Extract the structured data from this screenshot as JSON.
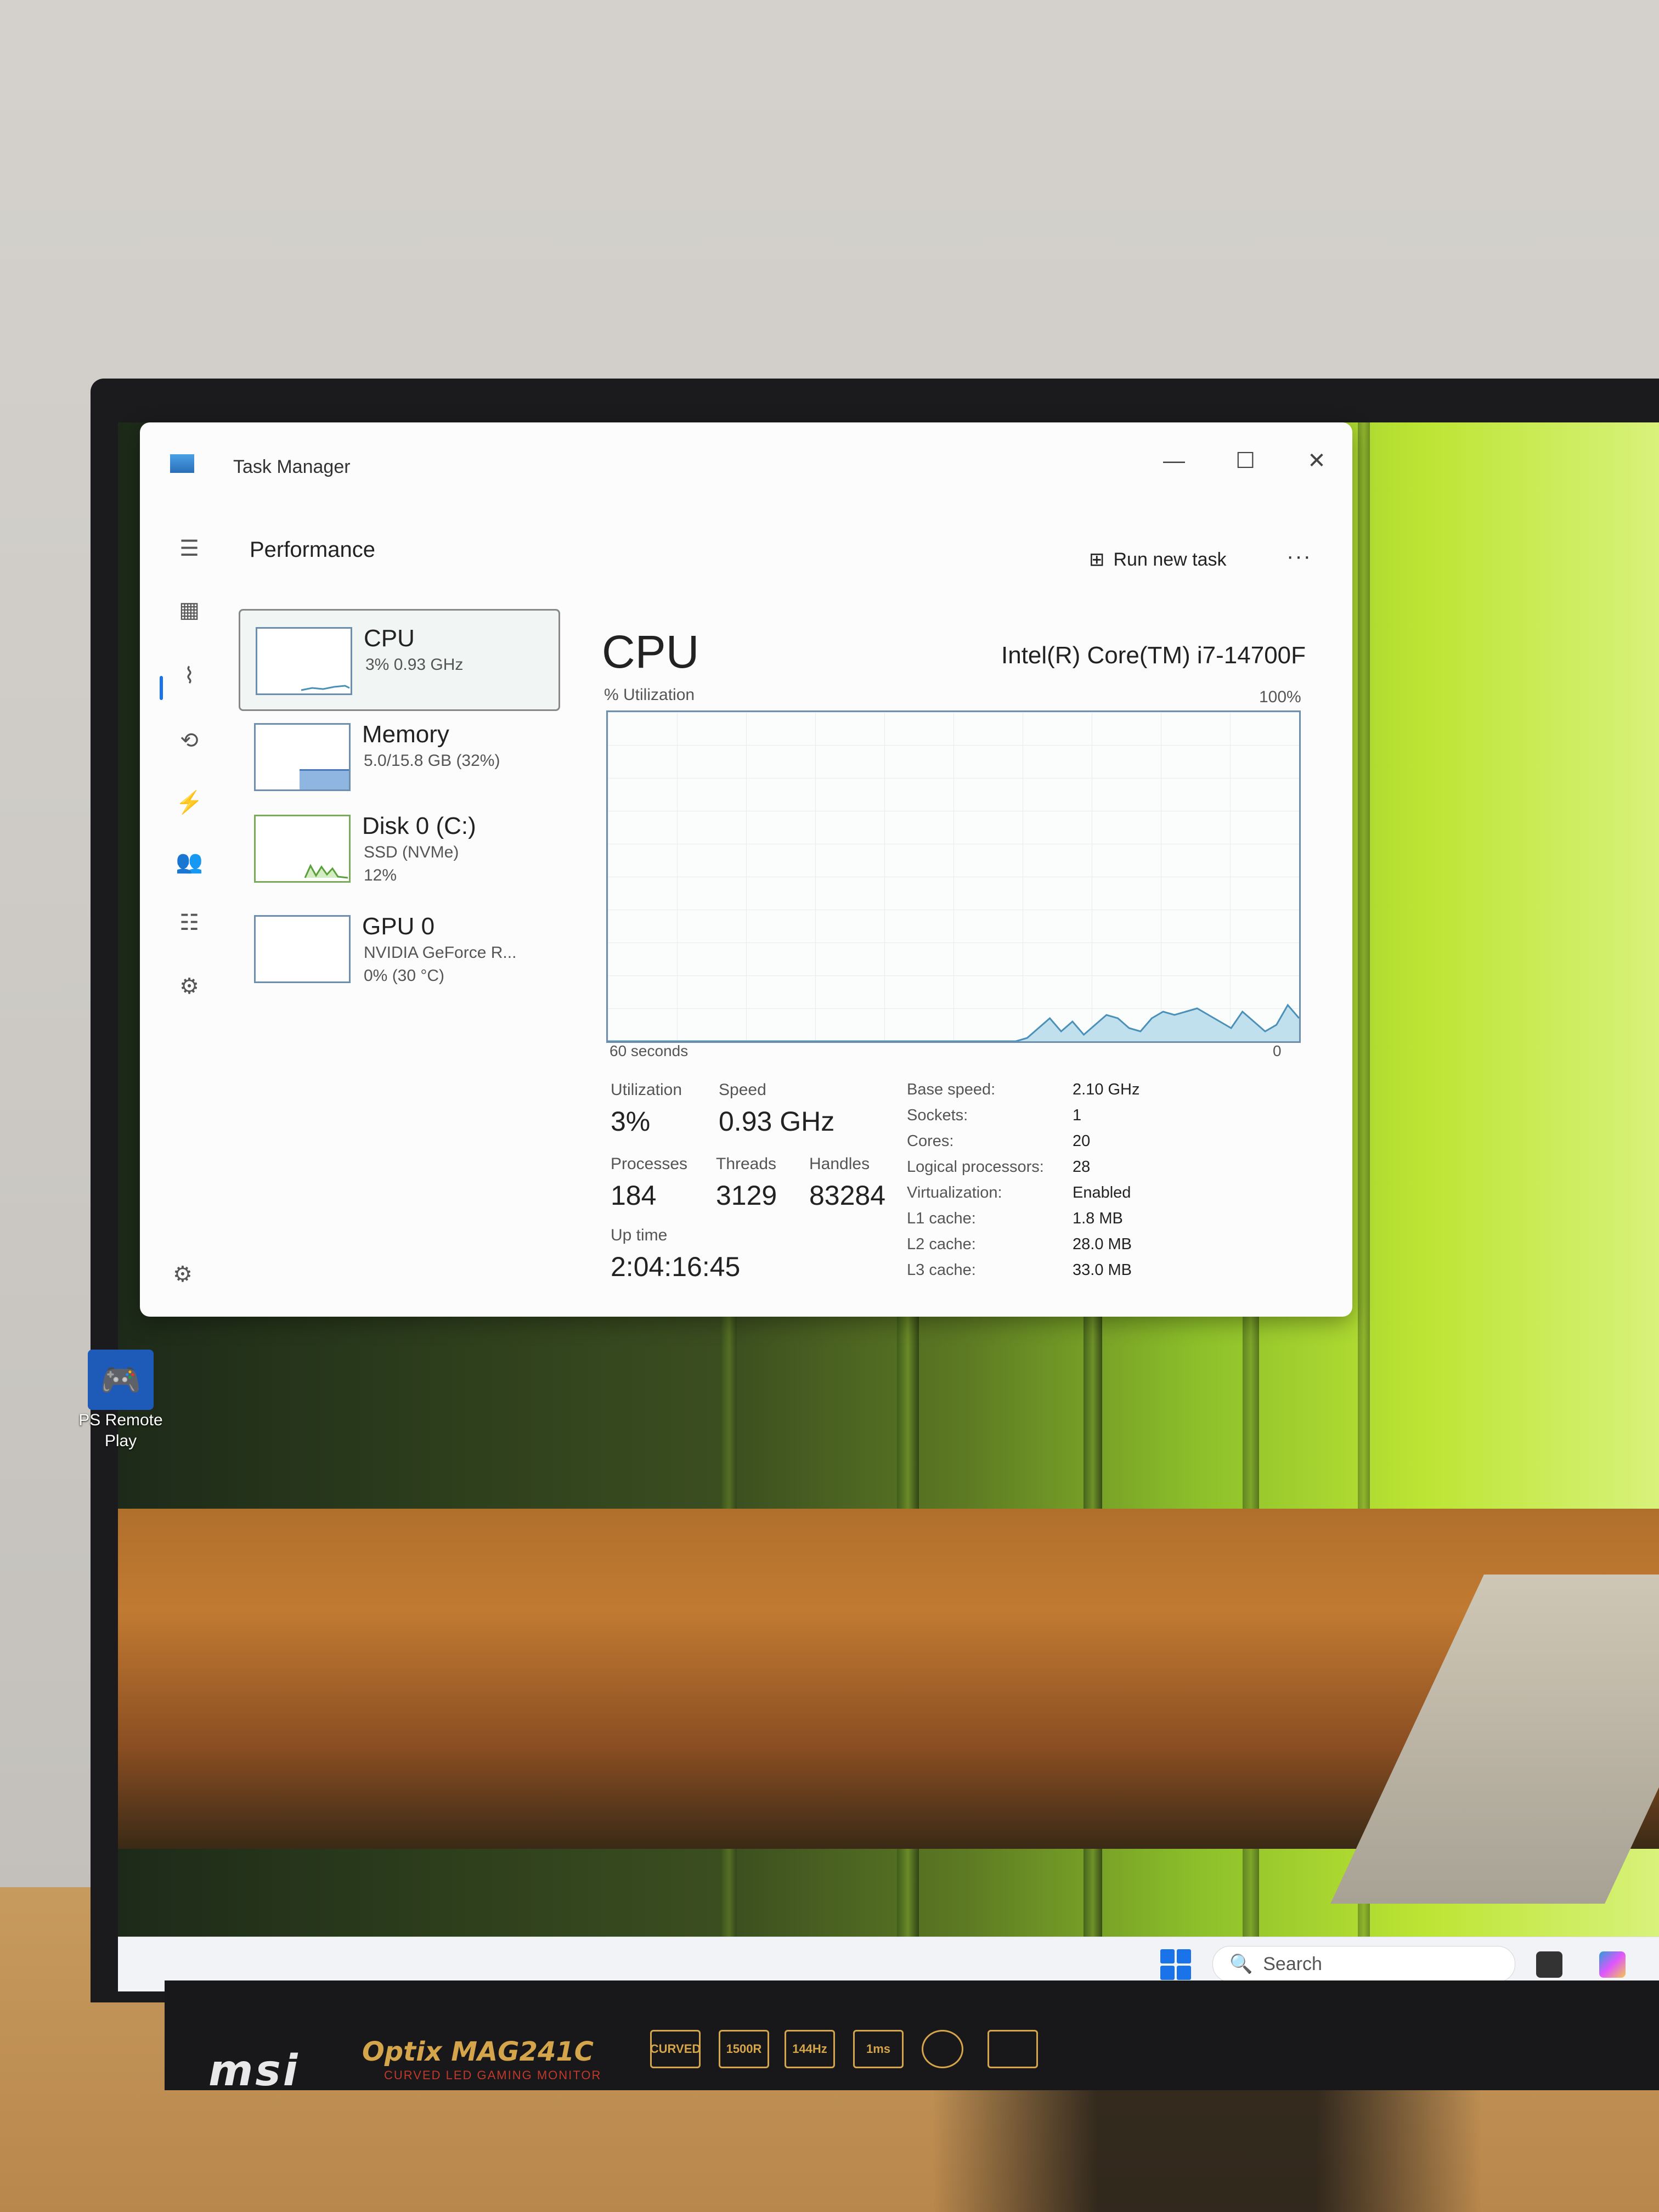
{
  "window": {
    "title": "Task Manager",
    "minimize_glyph": "—",
    "maximize_glyph": "☐",
    "close_glyph": "✕"
  },
  "toolbar": {
    "section": "Performance",
    "run_new_task": "Run new task",
    "more": "···"
  },
  "sidebar": [
    {
      "name": "CPU",
      "sub1": "3% 0.93 GHz",
      "sub2": ""
    },
    {
      "name": "Memory",
      "sub1": "5.0/15.8 GB (32%)",
      "sub2": ""
    },
    {
      "name": "Disk 0 (C:)",
      "sub1": "SSD (NVMe)",
      "sub2": "12%"
    },
    {
      "name": "GPU 0",
      "sub1": "NVIDIA GeForce R...",
      "sub2": "0% (30 °C)"
    }
  ],
  "main": {
    "title": "CPU",
    "model": "Intel(R) Core(TM) i7-14700F",
    "graph_label": "% Utilization",
    "graph_max": "100%",
    "graph_time": "60 seconds",
    "graph_min": "0"
  },
  "stats": {
    "utilization_label": "Utilization",
    "utilization": "3%",
    "speed_label": "Speed",
    "speed": "0.93 GHz",
    "processes_label": "Processes",
    "processes": "184",
    "threads_label": "Threads",
    "threads": "3129",
    "handles_label": "Handles",
    "handles": "83284",
    "uptime_label": "Up time",
    "uptime": "2:04:16:45"
  },
  "specs": [
    {
      "label": "Base speed:",
      "value": "2.10 GHz"
    },
    {
      "label": "Sockets:",
      "value": "1"
    },
    {
      "label": "Cores:",
      "value": "20"
    },
    {
      "label": "Logical processors:",
      "value": "28"
    },
    {
      "label": "Virtualization:",
      "value": "Enabled"
    },
    {
      "label": "L1 cache:",
      "value": "1.8 MB"
    },
    {
      "label": "L2 cache:",
      "value": "28.0 MB"
    },
    {
      "label": "L3 cache:",
      "value": "33.0 MB"
    }
  ],
  "desktop_icon": {
    "line1": "PS Remote",
    "line2": "Play",
    "icon": "gamepad-icon"
  },
  "taskbar": {
    "search_placeholder": "Search"
  },
  "bezel": {
    "brand": "msi",
    "model": "Optix MAG241C",
    "subtitle": "CURVED LED GAMING MONITOR",
    "badges": [
      "CURVED",
      "1500R",
      "144Hz",
      "1ms",
      "",
      ""
    ]
  },
  "colors": {
    "accent": "#1a73e8",
    "graph_fill": "#bfe0ec",
    "graph_line": "#4a90b8"
  },
  "chart_data": {
    "type": "area",
    "ylabel": "% Utilization",
    "ylim": [
      0,
      100
    ],
    "xlabel": "60 seconds",
    "y": [
      0,
      0,
      0,
      0,
      0,
      0,
      0,
      0,
      0,
      0,
      0,
      0,
      0,
      0,
      0,
      0,
      0,
      0,
      0,
      0,
      0,
      0,
      0,
      0,
      0,
      0,
      0,
      0,
      0,
      0,
      0,
      0,
      0,
      0,
      0,
      0,
      0,
      1,
      4,
      7,
      3,
      6,
      2,
      5,
      8,
      7,
      4,
      3,
      7,
      9,
      8,
      9,
      10,
      8,
      6,
      4,
      9,
      6,
      3,
      5,
      11,
      7
    ]
  }
}
